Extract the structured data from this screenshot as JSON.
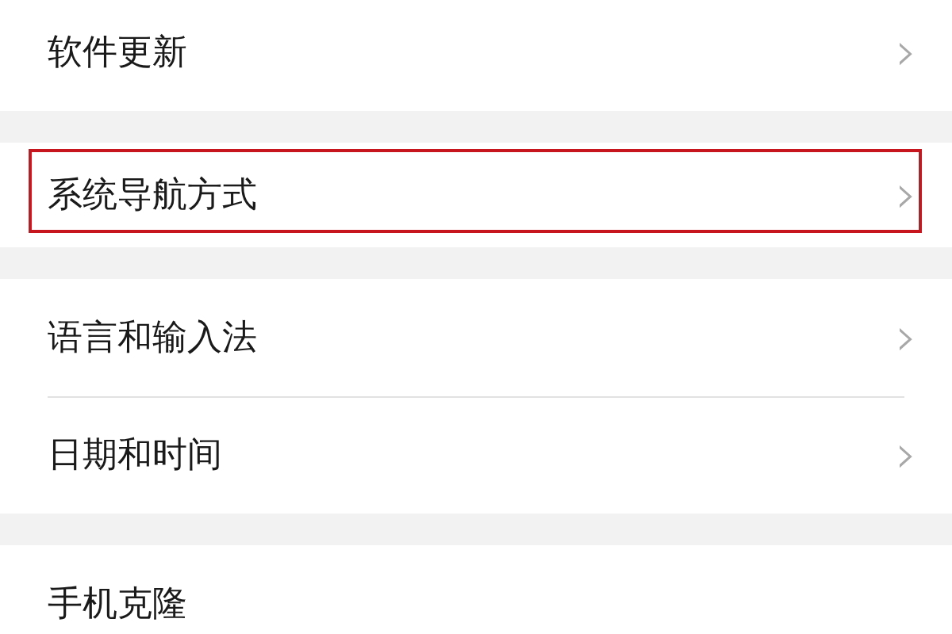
{
  "groups": [
    {
      "items": [
        {
          "label": "软件更新",
          "chevron": "›",
          "highlighted": false
        }
      ]
    },
    {
      "items": [
        {
          "label": "系统导航方式",
          "chevron": "›",
          "highlighted": true
        }
      ]
    },
    {
      "items": [
        {
          "label": "语言和输入法",
          "chevron": "›",
          "highlighted": false
        },
        {
          "label": "日期和时间",
          "chevron": "›",
          "highlighted": false
        }
      ]
    },
    {
      "items": [
        {
          "label": "手机克隆",
          "highlighted": false
        }
      ]
    }
  ]
}
